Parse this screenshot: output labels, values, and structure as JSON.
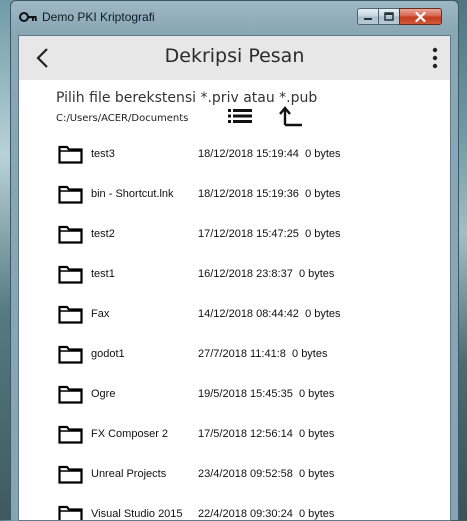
{
  "window": {
    "title": "Demo PKI Kriptografi"
  },
  "appbar": {
    "title": "Dekripsi Pesan",
    "back_icon": "back-arrow-icon",
    "menu_icon": "more-vertical-icon"
  },
  "chooser": {
    "heading": "Pilih file berekstensi *.priv atau *.pub",
    "path": "C:/Users/ACER/Documents",
    "view_icon": "list-view-icon",
    "up_icon": "parent-directory-icon"
  },
  "files": [
    {
      "name": "test3",
      "date": "18/12/2018 15:19:44",
      "size": "0 bytes"
    },
    {
      "name": "bin - Shortcut.lnk",
      "date": "18/12/2018 15:19:36",
      "size": "0 bytes"
    },
    {
      "name": "test2",
      "date": "17/12/2018 15:47:25",
      "size": "0 bytes"
    },
    {
      "name": "test1",
      "date": "16/12/2018 23:8:37",
      "size": "0 bytes"
    },
    {
      "name": "Fax",
      "date": "14/12/2018 08:44:42",
      "size": "0 bytes"
    },
    {
      "name": "godot1",
      "date": "27/7/2018 11:41:8",
      "size": "0 bytes"
    },
    {
      "name": "Ogre",
      "date": "19/5/2018 15:45:35",
      "size": "0 bytes"
    },
    {
      "name": "FX Composer 2",
      "date": "17/5/2018 12:56:14",
      "size": "0 bytes"
    },
    {
      "name": "Unreal Projects",
      "date": "23/4/2018 09:52:58",
      "size": "0 bytes"
    },
    {
      "name": "Visual Studio 2015",
      "date": "22/4/2018 09:30:24",
      "size": "0 bytes"
    }
  ],
  "colors": {
    "appbar_bg": "#e7e7e7",
    "close_button": "#c4381d"
  }
}
